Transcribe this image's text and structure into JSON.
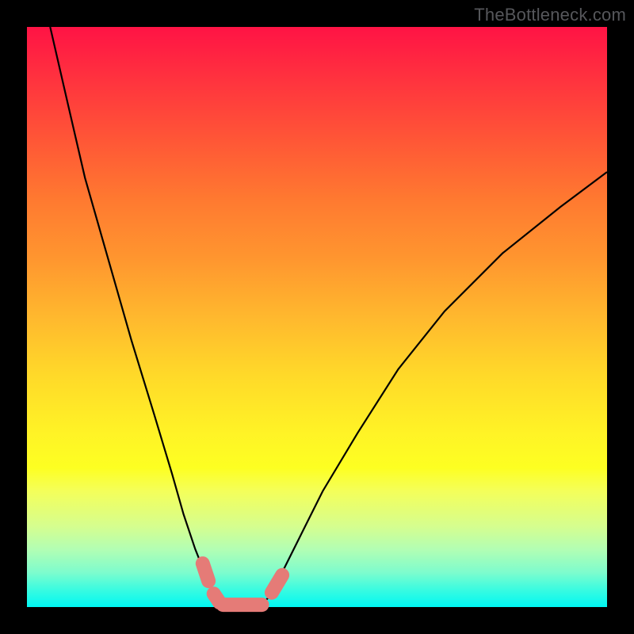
{
  "watermark": "TheBottleneck.com",
  "colors": {
    "frame": "#000000",
    "curve": "#000000",
    "bead": "#e57b77"
  },
  "chart_data": {
    "type": "line",
    "title": "",
    "xlabel": "",
    "ylabel": "",
    "xlim": [
      0,
      100
    ],
    "ylim": [
      0,
      100
    ],
    "grid": false,
    "legend": false,
    "background": "rainbow-vertical (red top → cyan bottom)",
    "series": [
      {
        "name": "left-branch",
        "x": [
          4,
          7,
          10,
          14,
          18,
          22,
          25,
          27,
          29,
          31,
          32.5,
          33.8
        ],
        "y": [
          100,
          87,
          74,
          60,
          46,
          33,
          23,
          16,
          10,
          5,
          2,
          0.5
        ]
      },
      {
        "name": "right-branch",
        "x": [
          40.5,
          42,
          44,
          47,
          51,
          57,
          64,
          72,
          82,
          92,
          100
        ],
        "y": [
          0.5,
          2,
          6,
          12,
          20,
          30,
          41,
          51,
          61,
          69,
          75
        ]
      },
      {
        "name": "valley-floor",
        "x": [
          33.8,
          35,
          36.5,
          38,
          39.5,
          40.5
        ],
        "y": [
          0.5,
          0.2,
          0.2,
          0.2,
          0.2,
          0.5
        ]
      }
    ],
    "markers": [
      {
        "name": "bead-left-upper",
        "path_x": [
          30.3,
          31.3
        ],
        "path_y": [
          7.5,
          4.5
        ]
      },
      {
        "name": "bead-left-lower",
        "path_x": [
          32.2,
          33.2
        ],
        "path_y": [
          2.3,
          0.8
        ]
      },
      {
        "name": "bead-floor",
        "path_x": [
          33.8,
          40.5
        ],
        "path_y": [
          0.4,
          0.4
        ]
      },
      {
        "name": "bead-right",
        "path_x": [
          42.2,
          44.0
        ],
        "path_y": [
          2.5,
          5.5
        ]
      }
    ]
  }
}
